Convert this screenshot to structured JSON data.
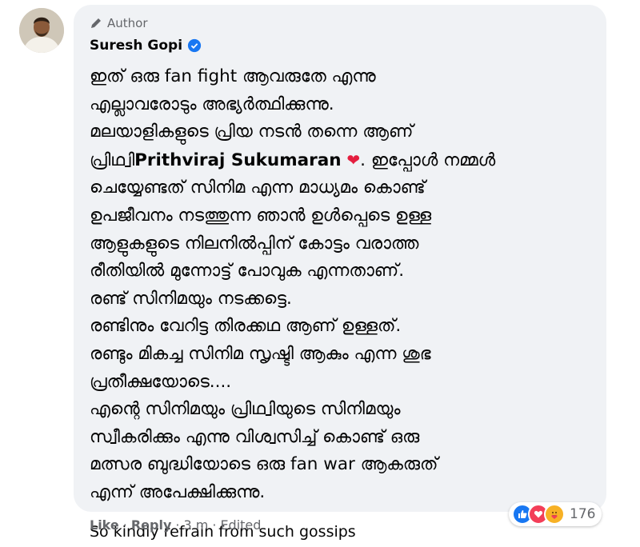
{
  "comment": {
    "badge": "Author",
    "name": "Suresh Gopi",
    "lines": [
      "ഇത് ഒരു fan fight ആവരുതേ എന്നു",
      "എല്ലാവരോടും അഭ്യർത്ഥിക്കുന്നു.",
      "മലയാളികളുടെ പ്രിയ നടൻ തന്നെ ആണ്",
      "",
      "ചെയ്യേണ്ടത് സിനിമ എന്ന മാധ്യമം കൊണ്ട്",
      "ഉപജീവനം നടത്തുന്ന ഞാൻ ഉൾപ്പെടെ ഉള്ള",
      "ആളുകളുടെ നിലനിൽപ്പിന് കോട്ടം വരാത്ത",
      "രീതിയിൽ മുന്നോട്ട് പോവുക എന്നതാണ്.",
      "രണ്ട് സിനിമയും നടക്കട്ടെ.",
      "രണ്ടിനും വേറിട്ട തിരക്കഥ ആണ് ഉള്ളത്.",
      "രണ്ടും മികച്ച സിനിമ സൃഷ്ടി ആകും എന്ന ശുഭ",
      "പ്രതീക്ഷയോടെ....",
      "എന്റെ സിനിമയും പ്രിഥ്വിയുടെ സിനിമയും",
      "സ്വീകരിക്കും എന്നു വിശ്വസിച്ച് കൊണ്ട് ഒരു",
      "മത്സര ബുദ്ധിയോടെ ഒരു fan war ആകരുത്",
      "എന്ന് അപേക്ഷിക്കുന്നു."
    ],
    "line4": {
      "prefix": "പ്രിഥ്വി",
      "mention": "Prithviraj Sukumaran",
      "heart": "❤",
      "suffix": ". ഇപ്പോൾ നമ്മൾ"
    },
    "closing": "So kindly refrain from such gossips",
    "reaction_count": "176",
    "like_label": "Like",
    "reply_label": "Reply",
    "time": "3 m",
    "edited": "Edited",
    "dot": "·"
  }
}
